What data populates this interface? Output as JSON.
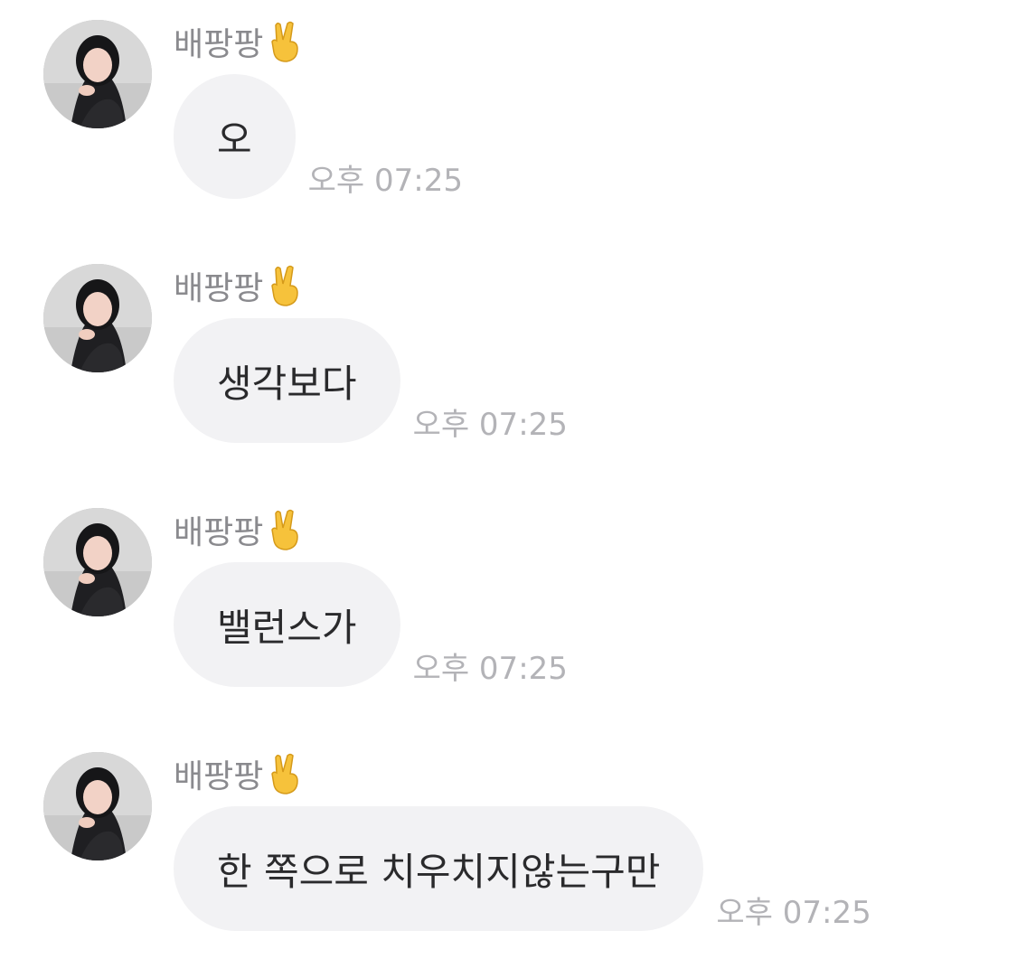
{
  "messages": [
    {
      "sender": "배팡팡",
      "sender_emoji": "victory-hand-icon",
      "text": "오",
      "time": "오후 07:25"
    },
    {
      "sender": "배팡팡",
      "sender_emoji": "victory-hand-icon",
      "text": "생각보다",
      "time": "오후 07:25"
    },
    {
      "sender": "배팡팡",
      "sender_emoji": "victory-hand-icon",
      "text": "밸런스가",
      "time": "오후 07:25"
    },
    {
      "sender": "배팡팡",
      "sender_emoji": "victory-hand-icon",
      "text": "한 쪽으로 치우치지않는구만",
      "time": "오후 07:25"
    }
  ],
  "colors": {
    "bubble_bg": "#f2f2f4",
    "sender_text": "#8a8a8e",
    "time_text": "#b3b3b7",
    "message_text": "#2a2a2c"
  }
}
